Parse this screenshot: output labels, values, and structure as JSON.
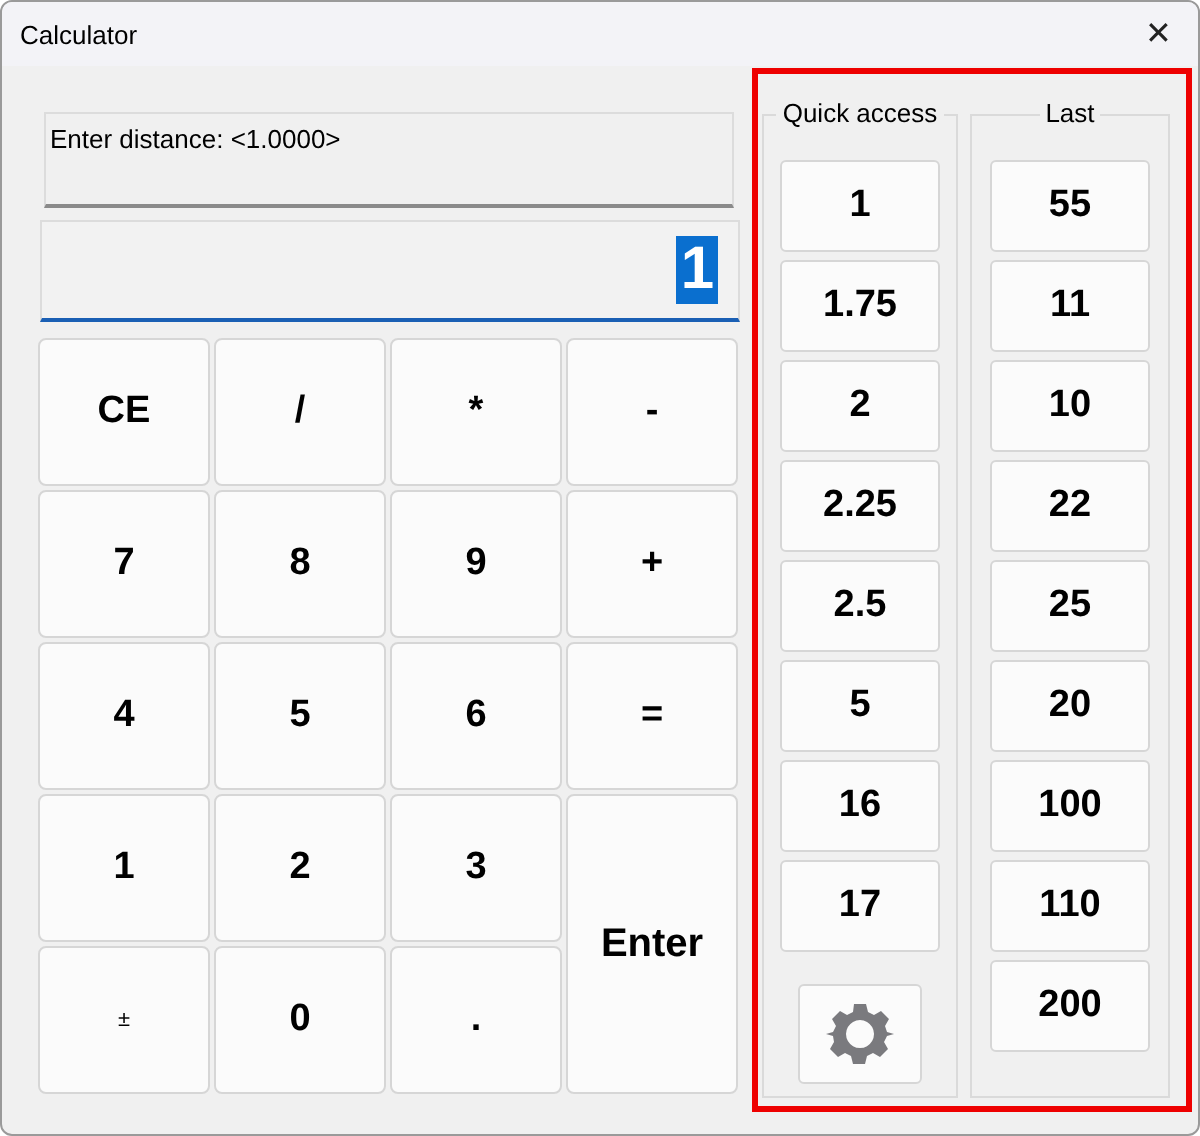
{
  "window": {
    "title": "Calculator",
    "close": "✕"
  },
  "prompt": "Enter distance:  <1.0000>",
  "display": {
    "value": "1",
    "selected": true
  },
  "keys": [
    {
      "label": "CE",
      "kind": "normal"
    },
    {
      "label": "/",
      "kind": "normal"
    },
    {
      "label": "*",
      "kind": "normal"
    },
    {
      "label": "-",
      "kind": "normal"
    },
    {
      "label": "7",
      "kind": "normal"
    },
    {
      "label": "8",
      "kind": "normal"
    },
    {
      "label": "9",
      "kind": "normal"
    },
    {
      "label": "+",
      "kind": "normal"
    },
    {
      "label": "4",
      "kind": "normal"
    },
    {
      "label": "5",
      "kind": "normal"
    },
    {
      "label": "6",
      "kind": "normal"
    },
    {
      "label": "=",
      "kind": "normal"
    },
    {
      "label": "1",
      "kind": "normal"
    },
    {
      "label": "2",
      "kind": "normal"
    },
    {
      "label": "3",
      "kind": "normal"
    },
    {
      "label": "Enter",
      "kind": "tall"
    },
    {
      "label": "±",
      "kind": "small"
    },
    {
      "label": "0",
      "kind": "normal"
    },
    {
      "label": ".",
      "kind": "normal"
    }
  ],
  "quick_access": {
    "title": "Quick access",
    "items": [
      "1",
      "1.75",
      "2",
      "2.25",
      "2.5",
      "5",
      "16",
      "17"
    ]
  },
  "last": {
    "title": "Last",
    "items": [
      "55",
      "11",
      "10",
      "22",
      "25",
      "20",
      "100",
      "110",
      "200"
    ]
  }
}
